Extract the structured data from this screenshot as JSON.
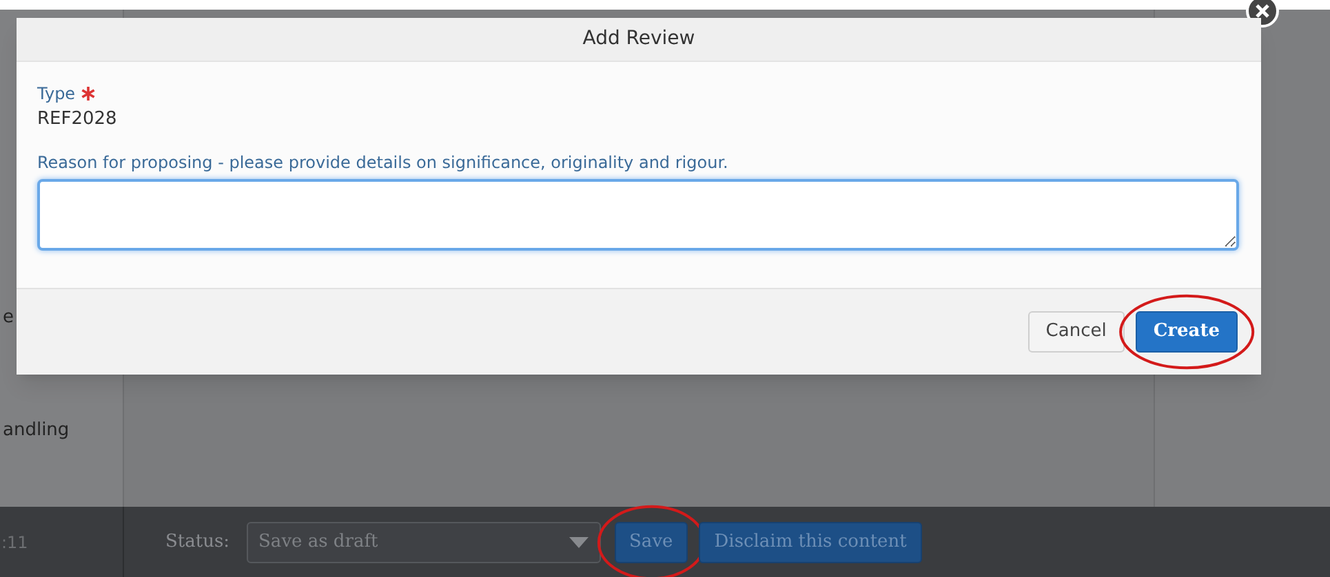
{
  "sidebar": {
    "texts": [
      "e",
      "andling"
    ]
  },
  "dialog": {
    "title": "Add Review",
    "fields": [
      {
        "kind": "value",
        "label": "Type",
        "required": true,
        "value": "REF2028"
      },
      {
        "kind": "textarea",
        "label": "Reason for proposing - please provide details on significance, originality and rigour.",
        "required": false,
        "focused": true
      }
    ],
    "buttons": [
      {
        "label": "Cancel",
        "primary": false,
        "circled": false
      },
      {
        "label": "Create",
        "primary": true,
        "circled": true
      }
    ]
  },
  "bottom_bar": {
    "time": ":11",
    "status_label": "Status:",
    "status_value": "Save as draft",
    "buttons": [
      {
        "label": "Save",
        "circled": true
      },
      {
        "label": "Disclaim this content",
        "circled": false
      }
    ]
  }
}
